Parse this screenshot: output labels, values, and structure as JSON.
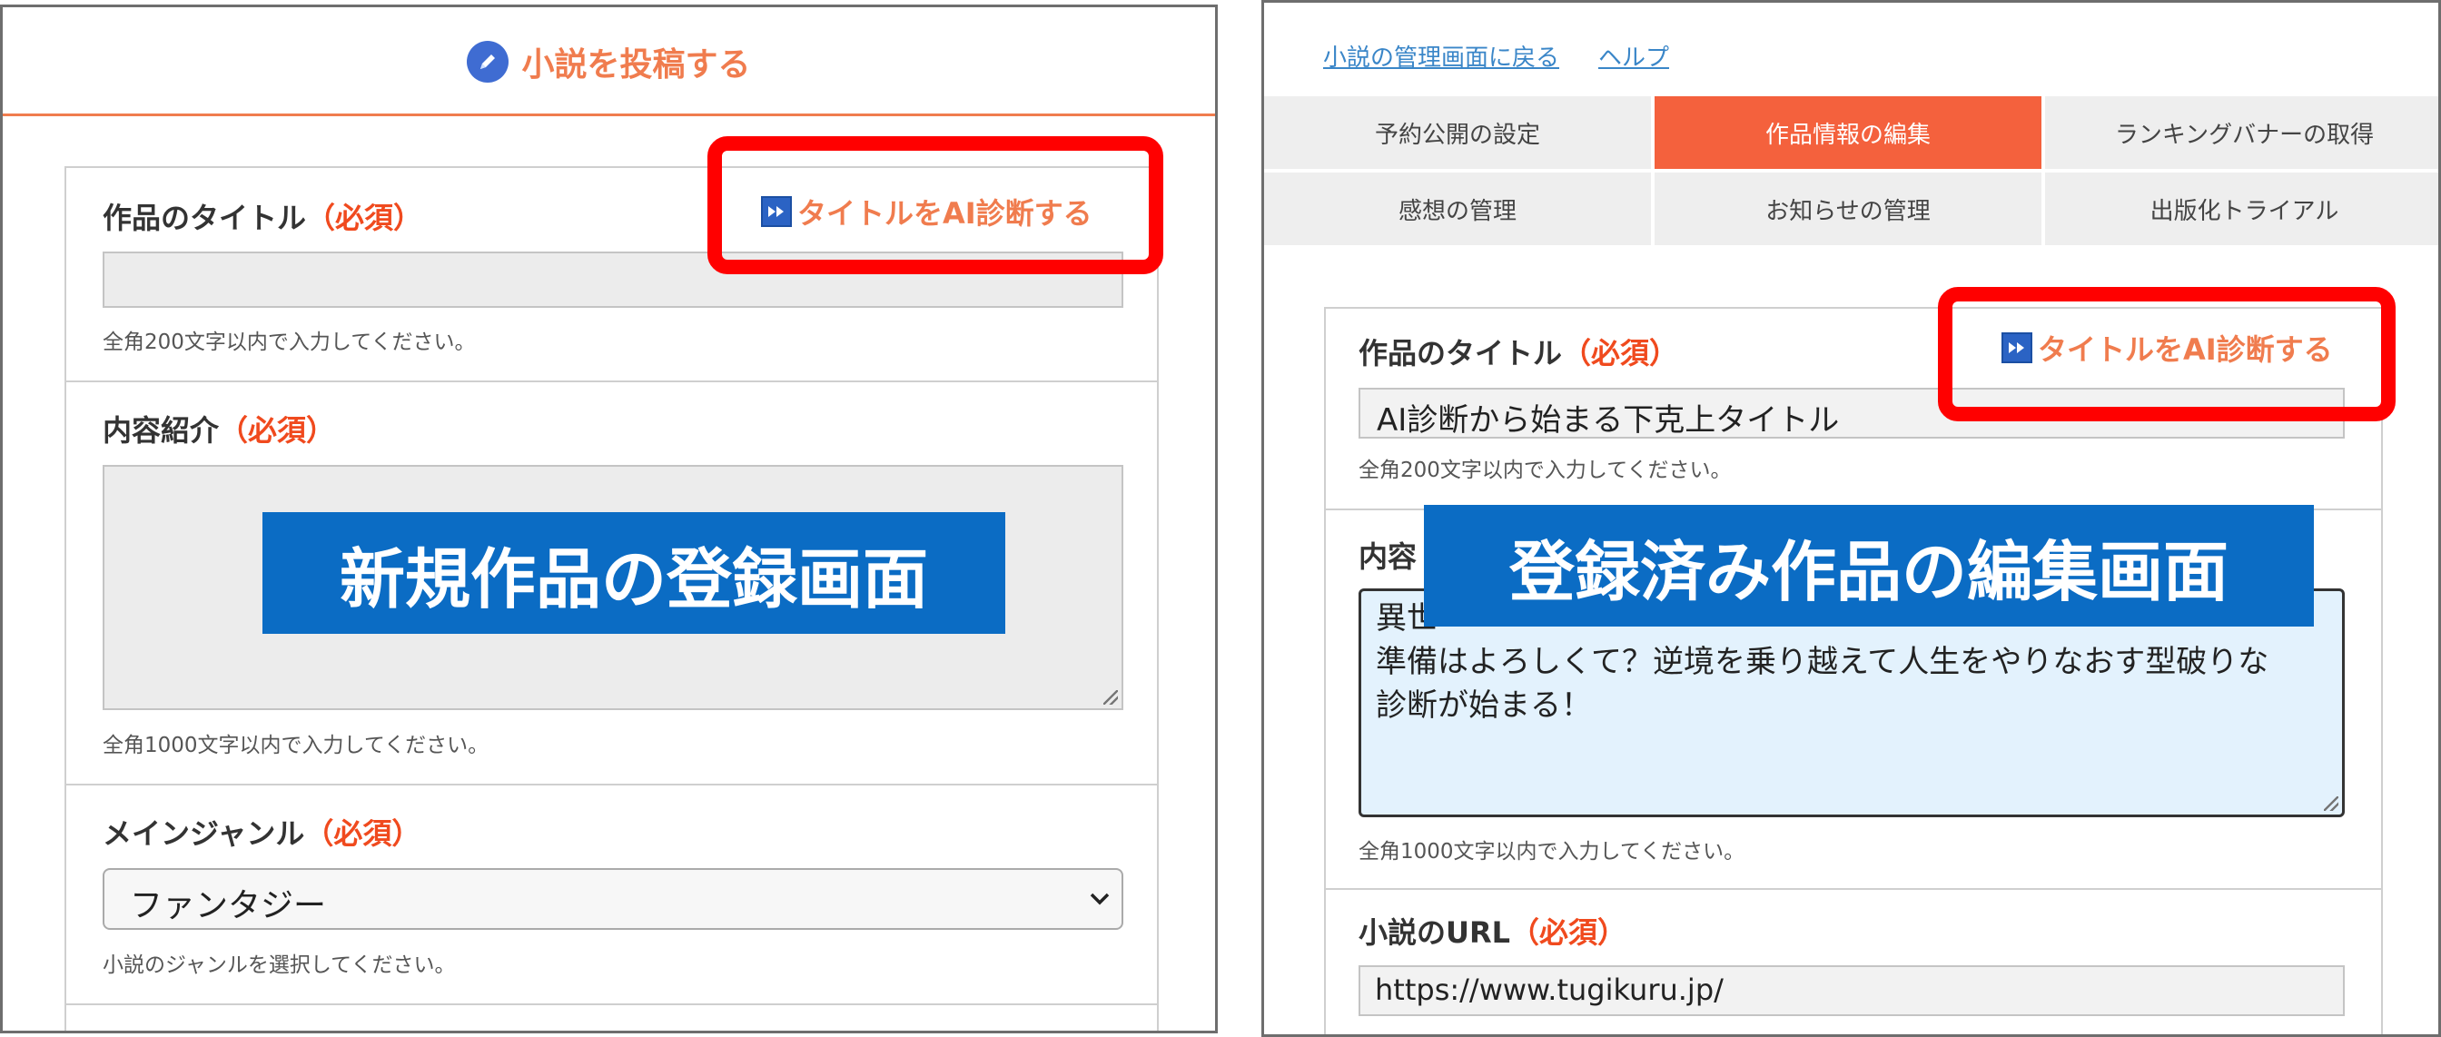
{
  "left": {
    "header_title": "小説を投稿する",
    "title_label": "作品のタイトル",
    "required": "（必須）",
    "ai_link": "タイトルをAI診断する",
    "title_help": "全角200文字以内で入力してください。",
    "intro_label": "内容紹介",
    "intro_help": "全角1000文字以内で入力してください。",
    "genre_label": "メインジャンル",
    "genre_selected": "ファンタジー",
    "genre_help": "小説のジャンルを選択してください。",
    "overlay": "新規作品の登録画面"
  },
  "right": {
    "links": [
      "小説の管理画面に戻る",
      "ヘルプ"
    ],
    "tabs": [
      "予約公開の設定",
      "作品情報の編集",
      "ランキングバナーの取得",
      "感想の管理",
      "お知らせの管理",
      "出版化トライアル"
    ],
    "active_tab": "作品情報の編集",
    "title_label": "作品のタイトル",
    "required": "（必須）",
    "ai_link": "タイトルをAI診断する",
    "title_value": "AI診断から始まる下克上タイトル",
    "title_help": "全角200文字以内で入力してください。",
    "intro_label_visible": "内容",
    "intro_line1_visible": "異世",
    "intro_line2": "準備はよろしくて？逆境を乗り越えて人生をやりなおす型破りな",
    "intro_line3": "診断が始まる！",
    "intro_help": "全角1000文字以内で入力してください。",
    "url_label": "小説のURL",
    "url_value": "https://www.tugikuru.jp/",
    "overlay": "登録済み作品の編集画面"
  },
  "colors": {
    "accent_orange": "#f07c4e",
    "required_red": "#f04a1e",
    "active_tab": "#f4613d",
    "highlight_frame": "#ff0000",
    "overlay_blue": "#0b6cc4",
    "textarea_blue": "#e3f2fd"
  }
}
